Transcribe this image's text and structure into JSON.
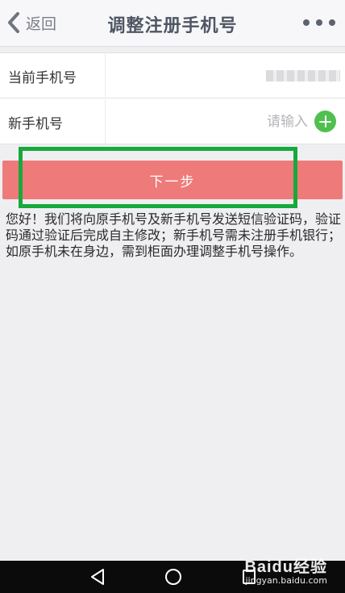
{
  "header": {
    "back_label": "返回",
    "title": "调整注册手机号"
  },
  "form": {
    "current_phone_label": "当前手机号",
    "new_phone_label": "新手机号",
    "new_phone_placeholder": "请输入",
    "new_phone_value": ""
  },
  "actions": {
    "next_label": "下一步"
  },
  "notice": "您好！我们将向原手机号及新手机号发送短信验证码，验证码通过验证后完成自主修改；新手机号需未注册手机银行；如原手机未在身边，需到柜面办理调整手机号操作。",
  "watermark": {
    "brand": "Baidu经验",
    "url": "jingyan.baidu.com"
  },
  "colors": {
    "primary_button": "#ef7a7a",
    "highlight_border": "#17a93c",
    "add_icon": "#4fc04f",
    "title_text": "#4f5663"
  }
}
